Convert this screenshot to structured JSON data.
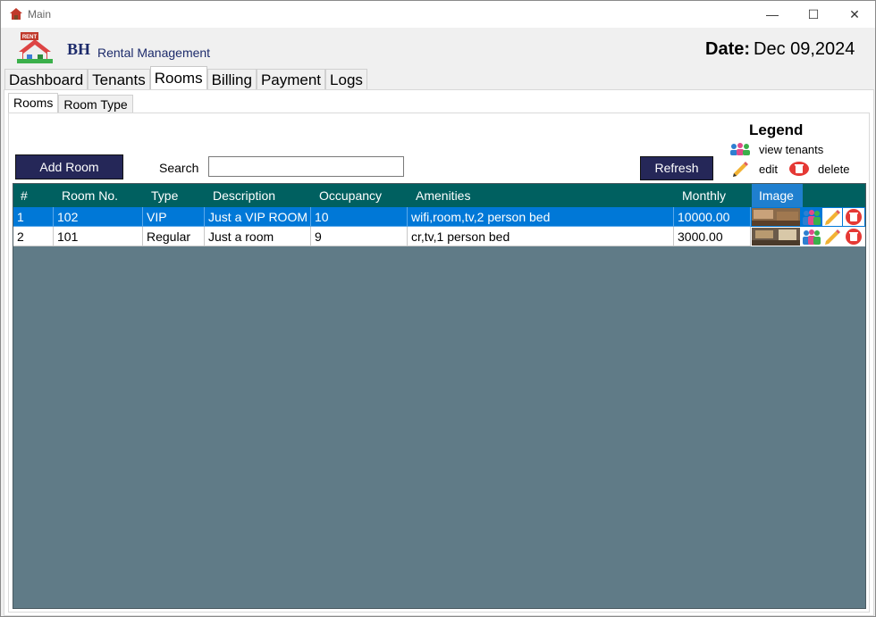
{
  "window": {
    "title": "Main",
    "minimize": "—",
    "maximize": "☐",
    "close": "✕"
  },
  "brand": {
    "short": "BH",
    "name": "Rental Management",
    "logo_text": "RENT"
  },
  "date": {
    "label": "Date:",
    "value": "Dec 09,2024"
  },
  "tabs": [
    {
      "label": "Dashboard",
      "active": false
    },
    {
      "label": "Tenants",
      "active": false
    },
    {
      "label": "Rooms",
      "active": true
    },
    {
      "label": "Billing",
      "active": false
    },
    {
      "label": "Payment",
      "active": false
    },
    {
      "label": "Logs",
      "active": false
    }
  ],
  "subtabs": [
    {
      "label": "Rooms",
      "active": true
    },
    {
      "label": "Room Type",
      "active": false
    }
  ],
  "toolbar": {
    "add_room": "Add Room",
    "search_label": "Search",
    "search_value": "",
    "refresh": "Refresh"
  },
  "legend": {
    "title": "Legend",
    "view_tenants": "view tenants",
    "edit": "edit",
    "delete": "delete"
  },
  "table": {
    "columns": [
      "#",
      "Room No.",
      "Type",
      "Description",
      "Occupancy",
      "Amenities",
      "Monthly",
      "Image"
    ],
    "rows": [
      {
        "num": "1",
        "room_no": "102",
        "type": "VIP",
        "description": "Just a VIP ROOM",
        "occupancy": "10",
        "amenities": "wifi,room,tv,2 person bed",
        "monthly": "10000.00",
        "selected": true
      },
      {
        "num": "2",
        "room_no": "101",
        "type": "Regular",
        "description": "Just a room",
        "occupancy": "9",
        "amenities": "cr,tv,1 person bed",
        "monthly": "3000.00",
        "selected": false
      }
    ]
  },
  "colors": {
    "accent": "#252758",
    "header": "#006060",
    "grid_bg": "#607b87",
    "selection": "#0078d7"
  }
}
